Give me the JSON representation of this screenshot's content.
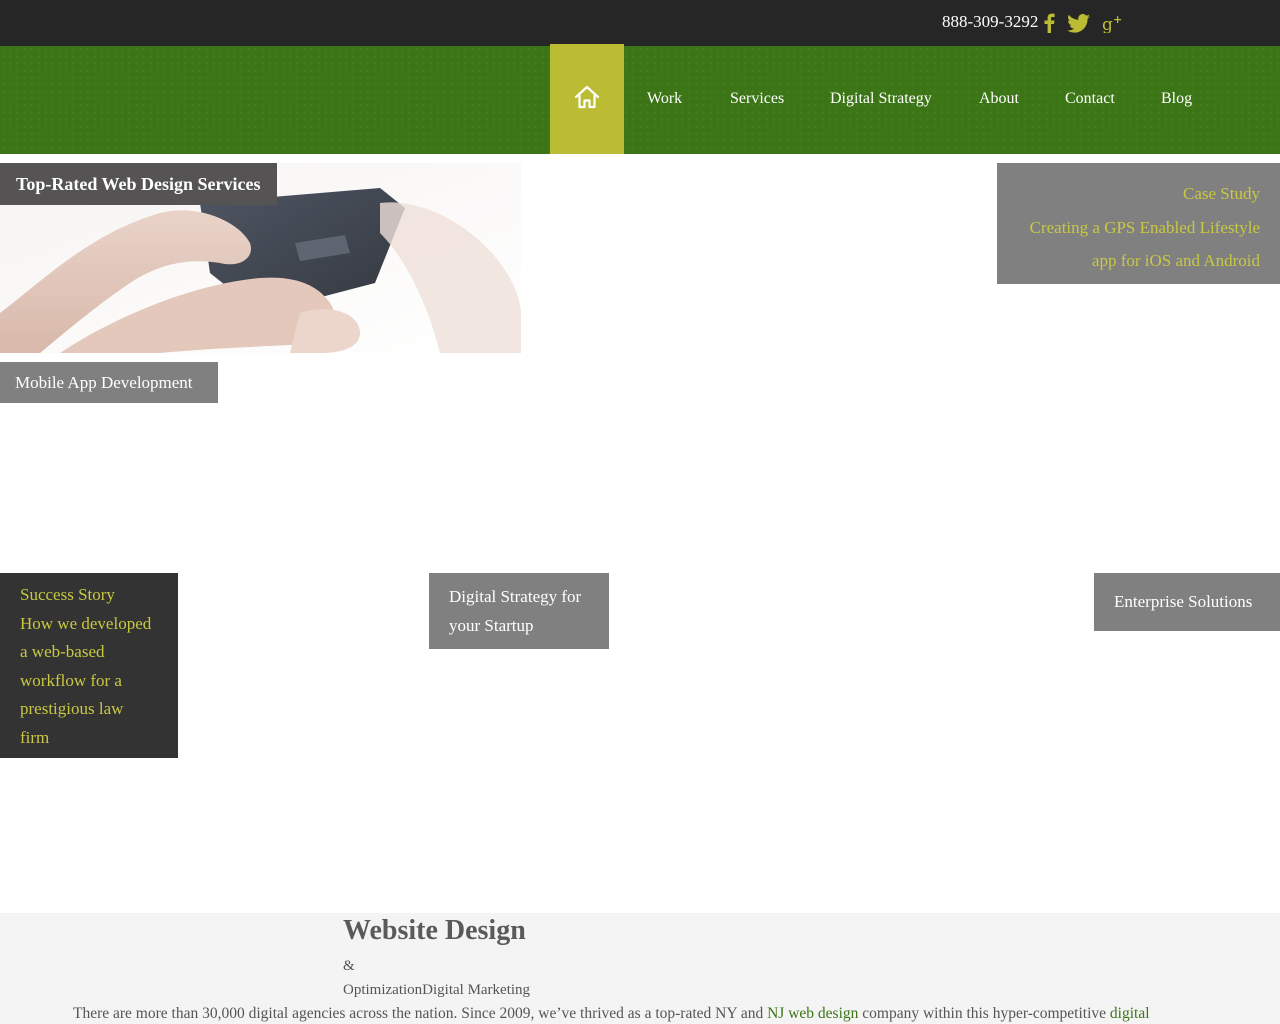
{
  "topbar": {
    "phone": "888-309-3292",
    "social": [
      "facebook-icon",
      "twitter-icon",
      "google-plus-icon"
    ],
    "accent_color": "#bcbc34"
  },
  "nav": {
    "home_icon": "home-icon",
    "items": [
      "Work",
      "Services",
      "Digital Strategy",
      "About",
      "Contact",
      "Blog"
    ],
    "bar_color": "#3b7516"
  },
  "hero": {
    "title": "Top-Rated Web Design Services",
    "mobile_label": "Mobile App Development"
  },
  "case_study": {
    "label": "Case Study",
    "line1": "Creating a GPS Enabled Lifestyle",
    "line2": "app for iOS and Android"
  },
  "success_story": {
    "lines": [
      "Success Story",
      "How we developed",
      "a web-based",
      "workflow for a",
      "prestigious law",
      "firm"
    ]
  },
  "startup": {
    "line1": "Digital Strategy for",
    "line2": "your Startup"
  },
  "enterprise": {
    "label": "Enterprise Solutions"
  },
  "bottom": {
    "heading": "Website Design",
    "amp": "&",
    "subline": "OptimizationDigital Marketing",
    "para_parts": [
      "There are more than 30,000 digital agencies across the nation. Since 2009, we’ve thrived as a top-rated NY and ",
      "NJ web design",
      " company within this hyper-competitive ",
      "digital"
    ]
  }
}
